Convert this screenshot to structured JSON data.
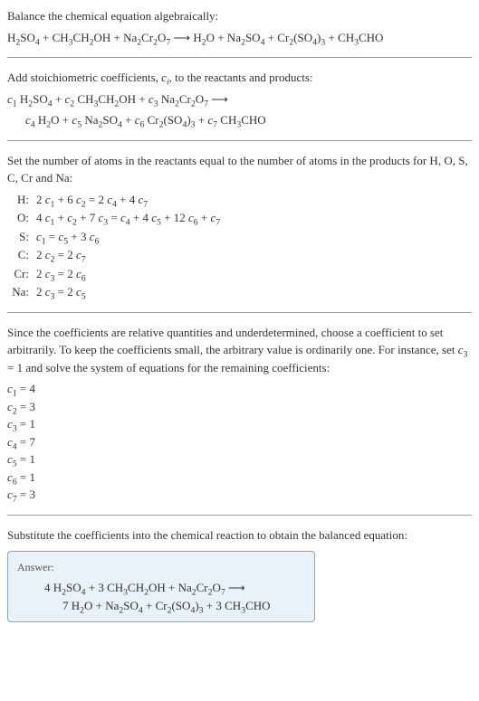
{
  "section1": {
    "intro": "Balance the chemical equation algebraically:",
    "equation": "H₂SO₄ + CH₃CH₂OH + Na₂Cr₂O₇ ⟶ H₂O + Na₂SO₄ + Cr₂(SO₄)₃ + CH₃CHO"
  },
  "section2": {
    "intro_pre": "Add stoichiometric coefficients, ",
    "intro_var": "cᵢ",
    "intro_post": ", to the reactants and products:",
    "eq_line1": "c₁ H₂SO₄ + c₂ CH₃CH₂OH + c₃ Na₂Cr₂O₇ ⟶",
    "eq_line2": "c₄ H₂O + c₅ Na₂SO₄ + c₆ Cr₂(SO₄)₃ + c₇ CH₃CHO"
  },
  "section3": {
    "intro": "Set the number of atoms in the reactants equal to the number of atoms in the products for H, O, S, C, Cr and Na:",
    "rows": [
      {
        "label": "H:",
        "eq": "2 c₁ + 6 c₂ = 2 c₄ + 4 c₇"
      },
      {
        "label": "O:",
        "eq": "4 c₁ + c₂ + 7 c₃ = c₄ + 4 c₅ + 12 c₆ + c₇"
      },
      {
        "label": "S:",
        "eq": "c₁ = c₅ + 3 c₆"
      },
      {
        "label": "C:",
        "eq": "2 c₂ = 2 c₇"
      },
      {
        "label": "Cr:",
        "eq": "2 c₃ = 2 c₆"
      },
      {
        "label": "Na:",
        "eq": "2 c₃ = 2 c₅"
      }
    ]
  },
  "section4": {
    "intro_p1": "Since the coefficients are relative quantities and underdetermined, choose a coefficient to set arbitrarily. To keep the coefficients small, the arbitrary value is ordinarily one. For instance, set ",
    "intro_var": "c₃ = 1",
    "intro_p2": " and solve the system of equations for the remaining coefficients:",
    "coeffs": [
      "c₁ = 4",
      "c₂ = 3",
      "c₃ = 1",
      "c₄ = 7",
      "c₅ = 1",
      "c₆ = 1",
      "c₇ = 3"
    ]
  },
  "section5": {
    "intro": "Substitute the coefficients into the chemical reaction to obtain the balanced equation:",
    "answer_label": "Answer:",
    "answer_line1": "4 H₂SO₄ + 3 CH₃CH₂OH + Na₂Cr₂O₇ ⟶",
    "answer_line2": "7 H₂O + Na₂SO₄ + Cr₂(SO₄)₃ + 3 CH₃CHO"
  }
}
